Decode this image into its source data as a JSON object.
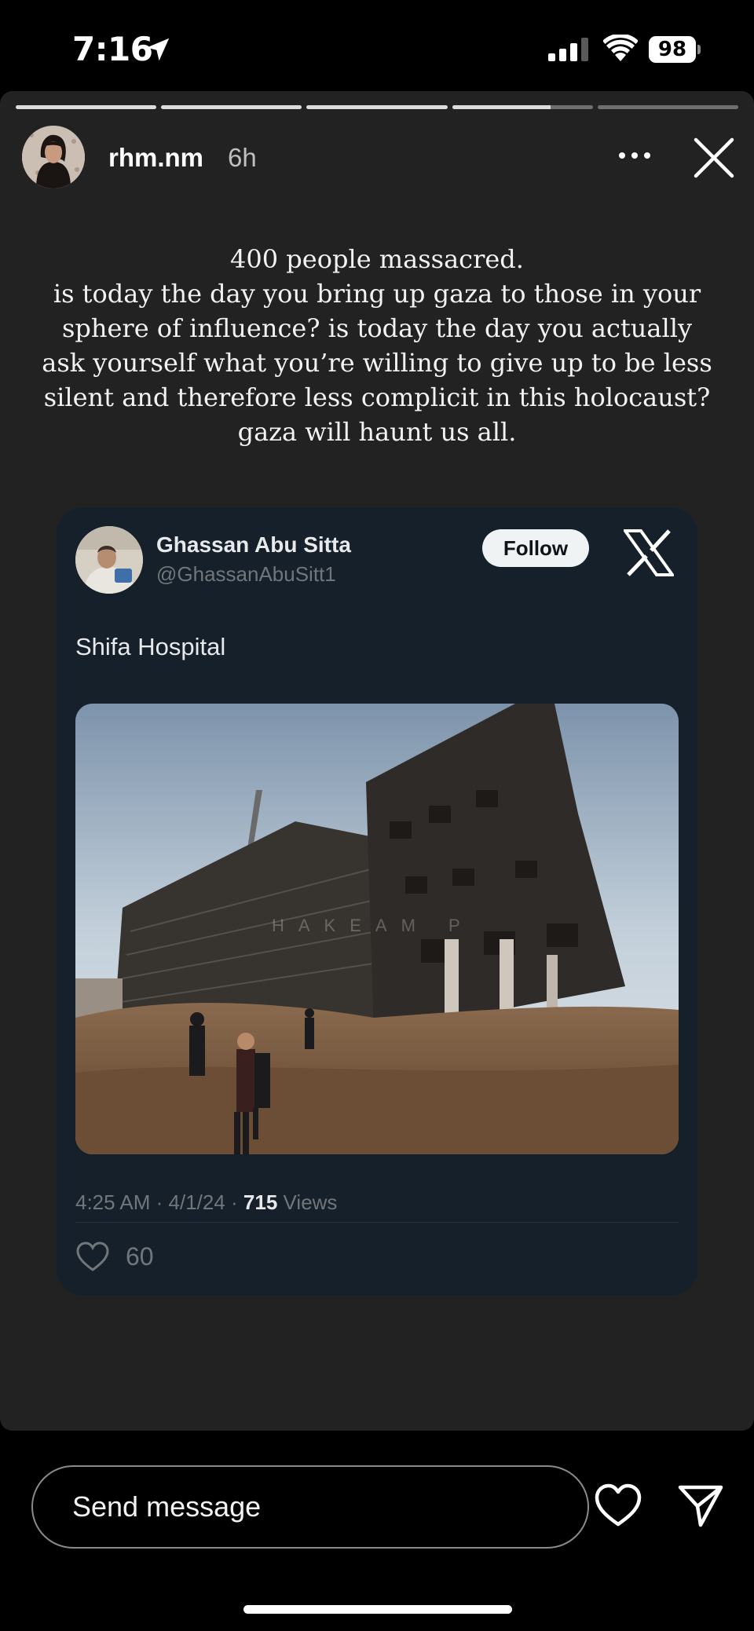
{
  "status_bar": {
    "time": "7:16",
    "battery": "98"
  },
  "story": {
    "progress": [
      1,
      1,
      1,
      0.7,
      0
    ],
    "username": "rhm.nm",
    "age": "6h",
    "caption_lines": [
      "400 people massacred.",
      "is today the day you bring up gaza to those in your",
      "sphere of influence? is today the day you actually",
      "ask yourself what you’re willing to give up to be less",
      "silent and therefore less complicit in this holocaust?",
      "gaza will haunt us all."
    ]
  },
  "tweet": {
    "name": "Ghassan Abu Sitta",
    "handle": "@GhassanAbuSitt1",
    "follow_label": "Follow",
    "text": "Shifa Hospital",
    "time": "4:25 AM",
    "date": "4/1/24",
    "views_count": "715",
    "views_label": "Views",
    "likes": "60",
    "photo_watermark": "HAKEAM P"
  },
  "reply_bar": {
    "placeholder": "Send message"
  },
  "icons": {
    "location": "location-arrow-icon",
    "signal": "cell-signal-icon",
    "wifi": "wifi-icon",
    "more": "more-icon",
    "close": "close-icon",
    "x_logo": "x-logo-icon",
    "heart": "heart-icon",
    "send": "send-icon"
  }
}
